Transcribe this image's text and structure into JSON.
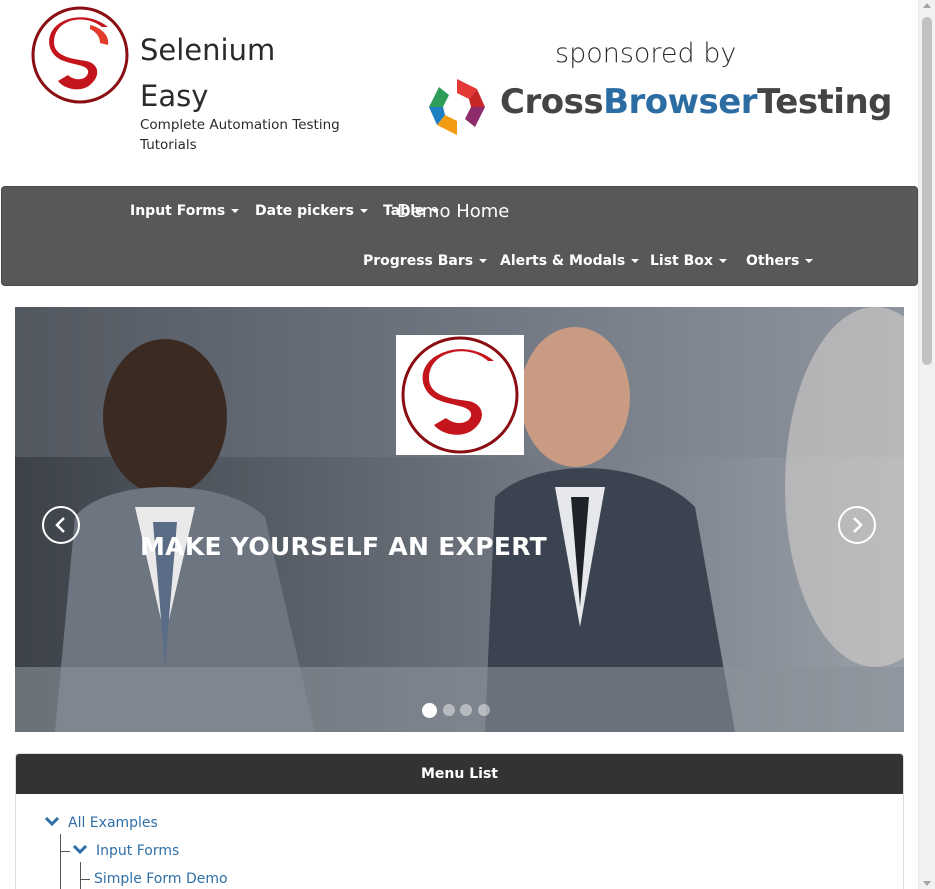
{
  "header": {
    "brand_line1": "Selenium",
    "brand_line2": "Easy",
    "tagline_line1": "Complete Automation Testing",
    "tagline_line2": "Tutorials",
    "sponsored": "sponsored by",
    "sponsor": {
      "part1": "Cross",
      "part2": "Browser",
      "part3": "Testing"
    }
  },
  "navbar": {
    "row1": [
      "Input Forms",
      "Date pickers",
      "Table"
    ],
    "demo_home": "Demo Home",
    "row2": [
      "Progress Bars",
      "Alerts & Modals",
      "List Box",
      "Others"
    ]
  },
  "carousel": {
    "caption": "MAKE YOURSELF AN EXPERT",
    "slide_count": 4,
    "active_slide": 1
  },
  "menu_panel": {
    "title": "Menu List",
    "tree": [
      "All Examples",
      "Input Forms",
      "Simple Form Demo"
    ]
  },
  "colors": {
    "navbar": "#585858",
    "panel_head": "#333333",
    "link": "#2f6fa8",
    "brand_red": "#c4151c"
  }
}
